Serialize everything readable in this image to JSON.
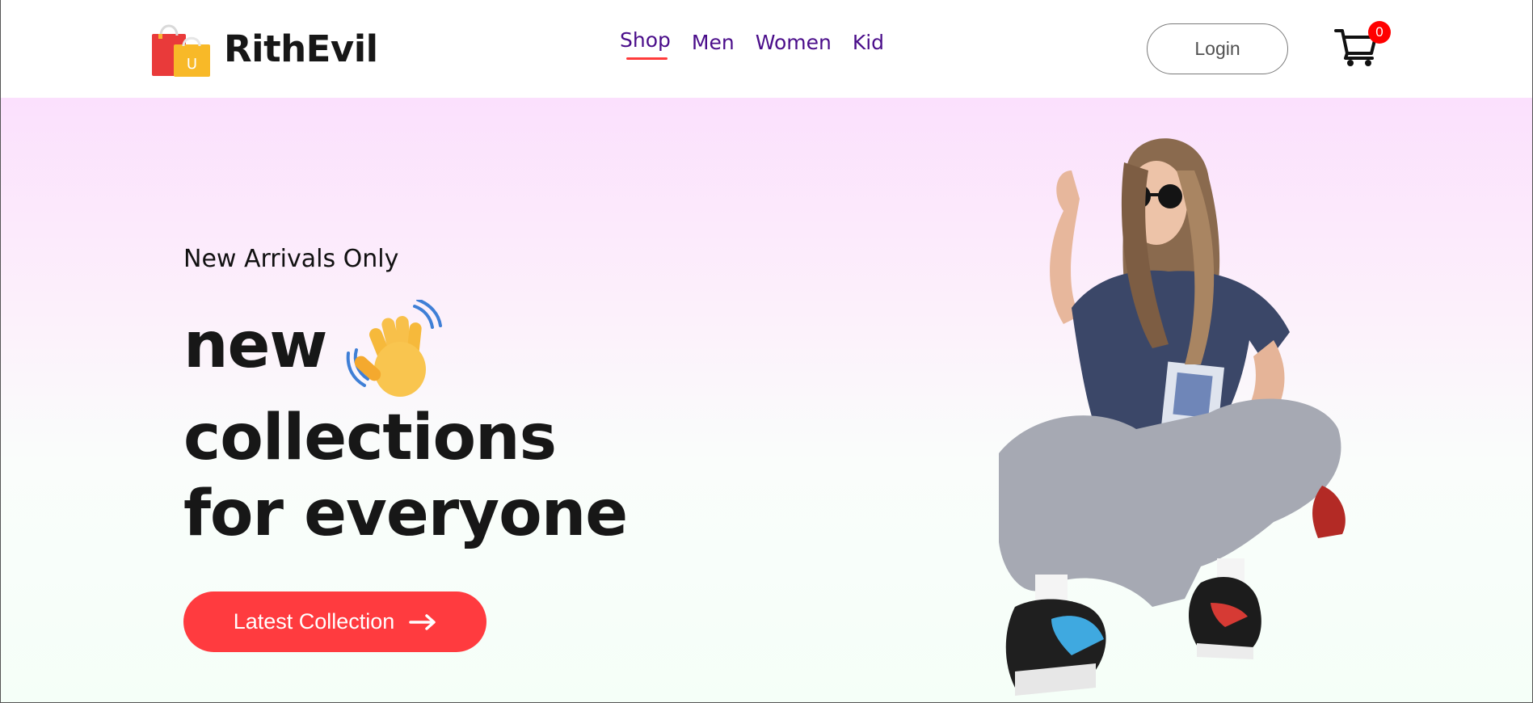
{
  "brand": {
    "name": "RithEvil",
    "logo_icon": "shopping-bags-icon",
    "logo_letter": "U"
  },
  "nav": {
    "items": [
      {
        "label": "Shop",
        "active": true
      },
      {
        "label": "Men",
        "active": false
      },
      {
        "label": "Women",
        "active": false
      },
      {
        "label": "Kid",
        "active": false
      }
    ]
  },
  "header": {
    "login_label": "Login",
    "cart_icon": "cart-icon",
    "cart_count": "0"
  },
  "hero": {
    "eyebrow": "New Arrivals Only",
    "line1": "new",
    "line1_emoji": "waving-hand-icon",
    "line2": "collections",
    "line3": "for everyone",
    "cta_label": "Latest Collection",
    "cta_icon": "arrow-right-icon",
    "image": "model-photo"
  },
  "colors": {
    "accent": "#ff3b3f",
    "nav_text": "#4a0d8a",
    "badge": "#ff0000",
    "hero_gradient_top": "#fbe0fd",
    "hero_gradient_bottom": "#f5fff8"
  }
}
